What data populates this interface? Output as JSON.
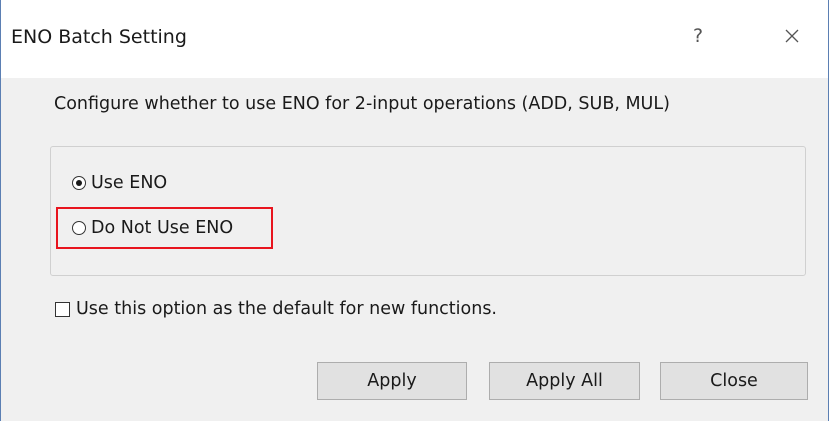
{
  "window": {
    "title": "ENO Batch Setting",
    "help_glyph": "?",
    "close_icon": "close-icon"
  },
  "description": "Configure whether to use ENO for 2-input operations (ADD, SUB, MUL)",
  "options": [
    {
      "label": "Use ENO",
      "selected": true
    },
    {
      "label": "Do Not Use ENO",
      "selected": false,
      "highlighted": true
    }
  ],
  "highlight_color": "#e8141e",
  "default_checkbox": {
    "label": "Use this option as the default for new functions.",
    "checked": false
  },
  "buttons": {
    "apply": "Apply",
    "apply_all": "Apply All",
    "close": "Close"
  }
}
